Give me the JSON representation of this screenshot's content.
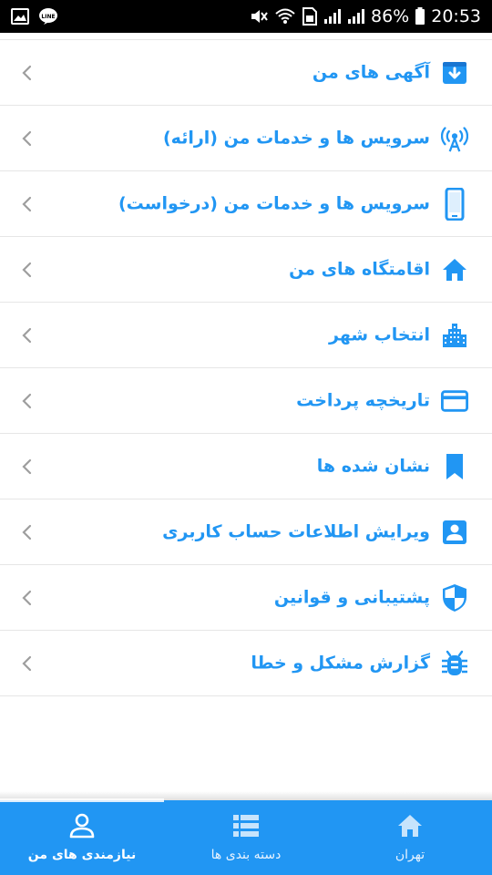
{
  "status_bar": {
    "battery": "86%",
    "time": "20:53",
    "left_icons": [
      "image-icon",
      "line-app-icon"
    ],
    "right_icons": [
      "mute-icon",
      "wifi-icon",
      "sim-icon",
      "signal-icon",
      "signal-icon",
      "battery-icon"
    ]
  },
  "menu": {
    "items": [
      {
        "label": "آگهی های من",
        "icon": "download-box-icon"
      },
      {
        "label": "سرویس ها و خدمات من (ارائه)",
        "icon": "broadcast-tower-icon"
      },
      {
        "label": "سرویس ها و خدمات من (درخواست)",
        "icon": "smartphone-icon"
      },
      {
        "label": "اقامتگاه های من",
        "icon": "home-icon"
      },
      {
        "label": "انتخاب شهر",
        "icon": "city-icon"
      },
      {
        "label": "تاریخچه پرداخت",
        "icon": "credit-card-icon"
      },
      {
        "label": "نشان شده ها",
        "icon": "bookmark-icon"
      },
      {
        "label": "ویرایش اطلاعات حساب کاربری",
        "icon": "account-box-icon"
      },
      {
        "label": "پشتیبانی و قوانین",
        "icon": "security-shield-icon"
      },
      {
        "label": "گزارش مشکل و خطا",
        "icon": "bug-icon"
      }
    ]
  },
  "bottom_nav": {
    "tabs": [
      {
        "label": "نیازمندی های من",
        "icon": "person-icon",
        "active": true
      },
      {
        "label": "دسته بندی ها",
        "icon": "list-icon",
        "active": false
      },
      {
        "label": "تهران",
        "icon": "home-icon",
        "active": false
      }
    ]
  },
  "colors": {
    "accent": "#2196f3",
    "status_bar": "#000000",
    "divider": "#e6e6e6",
    "chevron": "#9e9e9e"
  }
}
